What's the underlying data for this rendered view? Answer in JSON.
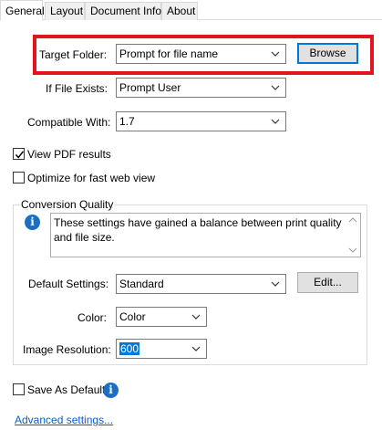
{
  "tabs": [
    {
      "label": "General",
      "active": true
    },
    {
      "label": "Layout",
      "active": false
    },
    {
      "label": "Document Info",
      "active": false
    },
    {
      "label": "About",
      "active": false
    }
  ],
  "target_folder": {
    "label": "Target Folder:",
    "value": "Prompt for file name",
    "browse_label": "Browse"
  },
  "if_file_exists": {
    "label": "If File Exists:",
    "value": "Prompt User"
  },
  "compatible_with": {
    "label": "Compatible With:",
    "value": "1.7"
  },
  "view_pdf": {
    "label": "View PDF results",
    "checked": true
  },
  "optimize_web": {
    "label": "Optimize for fast web view",
    "checked": false
  },
  "conversion_quality": {
    "title": "Conversion Quality",
    "description": "These settings have gained a balance between print quality and file size.",
    "default_settings": {
      "label": "Default Settings:",
      "value": "Standard",
      "edit_label": "Edit..."
    },
    "color": {
      "label": "Color:",
      "value": "Color"
    },
    "image_resolution": {
      "label": "Image Resolution:",
      "value": "600"
    }
  },
  "save_as_default": {
    "label": "Save As Default",
    "checked": false
  },
  "advanced_settings_link": "Advanced settings...",
  "colors": {
    "highlight": "#e3141d",
    "accent": "#0078d7",
    "info_icon": "#1a6fc4",
    "link": "#0a5cc7"
  },
  "icons": {
    "dropdown": "chevron-down-icon",
    "info": "info-icon",
    "check": "checkmark-icon"
  }
}
